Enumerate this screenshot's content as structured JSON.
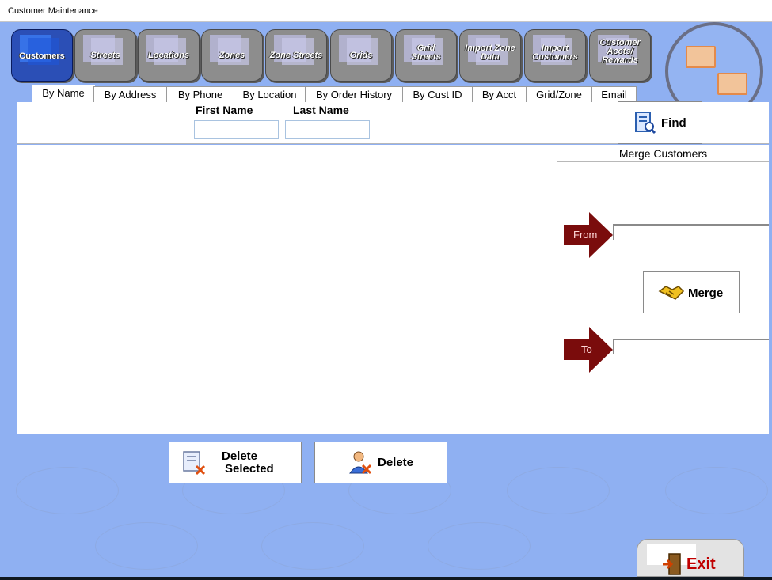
{
  "window": {
    "title": "Customer Maintenance"
  },
  "nav": {
    "items": [
      {
        "label": "Customers",
        "active": true
      },
      {
        "label": "Streets"
      },
      {
        "label": "Locations"
      },
      {
        "label": "Zones"
      },
      {
        "label": "Zone Streets"
      },
      {
        "label": "Grids"
      },
      {
        "label": "Grid Streets"
      },
      {
        "label": "Import Zone Data"
      },
      {
        "label": "Import Customers"
      },
      {
        "label": "Customer Accts/ Rewards"
      }
    ]
  },
  "subtabs": [
    {
      "label": "By Name",
      "active": true
    },
    {
      "label": "By Address"
    },
    {
      "label": "By Phone"
    },
    {
      "label": "By Location"
    },
    {
      "label": "By Order History"
    },
    {
      "label": "By Cust ID"
    },
    {
      "label": "By Acct"
    },
    {
      "label": "Grid/Zone"
    },
    {
      "label": "Email"
    }
  ],
  "search": {
    "first_name_label": "First Name",
    "last_name_label": "Last Name",
    "first_name_value": "",
    "last_name_value": "",
    "find_label": "Find"
  },
  "merge": {
    "header": "Merge Customers",
    "from_label": "From",
    "to_label": "To",
    "merge_label": "Merge"
  },
  "actions": {
    "delete_selected_line1": "Delete",
    "delete_selected_line2": "Selected",
    "delete_label": "Delete"
  },
  "exit_label": "Exit",
  "icons": {
    "find": "find-document-icon",
    "merge": "handshake-icon",
    "delete_selected": "delete-document-icon",
    "delete": "delete-user-icon",
    "exit": "exit-door-icon",
    "logo": "network-monitors-icon"
  },
  "colors": {
    "background": "#8fb0f2",
    "active_nav": "#2b4fb6",
    "nav": "#8d8d8d",
    "arrow": "#7a0c0c",
    "exit_text": "#c00000"
  }
}
